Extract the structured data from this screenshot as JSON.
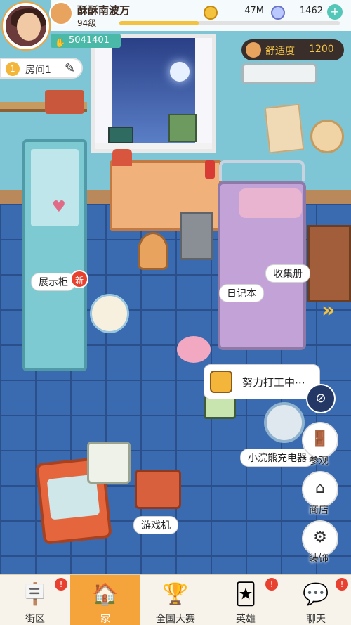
{
  "player": {
    "name": "酥酥南波万",
    "level": "94级",
    "id": "5041401",
    "xp_progress": 0.36
  },
  "currency": {
    "coins": "47M",
    "gems": "1462",
    "plus": "+"
  },
  "comfort": {
    "label": "舒适度",
    "value": "1200"
  },
  "room": {
    "number": "1",
    "name": "房间1"
  },
  "labels": {
    "display_cabinet": "展示柜",
    "new_badge": "新",
    "diary": "日记本",
    "album": "收集册",
    "working": "努力打工中⋯",
    "robot": "小浣熊充电器",
    "game_machine": "游戏机"
  },
  "side_buttons": {
    "visit": "参观",
    "shop": "商店",
    "decorate": "装饰"
  },
  "nav": [
    {
      "label": "街区",
      "badge": "!"
    },
    {
      "label": "家",
      "badge": ""
    },
    {
      "label": "全国大赛",
      "badge": ""
    },
    {
      "label": "英雄",
      "badge": "!"
    },
    {
      "label": "聊天",
      "badge": "!"
    }
  ],
  "colors": {
    "accent": "#f4a43a",
    "badge": "#e8412f",
    "id_badge": "#4bb9a8",
    "comfort_text": "#f5c545"
  },
  "icons": {
    "coin": "coin-icon",
    "gem": "gem-icon",
    "edit": "edit-icon",
    "eye_off": "eye-off-icon",
    "door": "door-icon",
    "shop": "shop-icon",
    "gear": "gear-icon"
  }
}
